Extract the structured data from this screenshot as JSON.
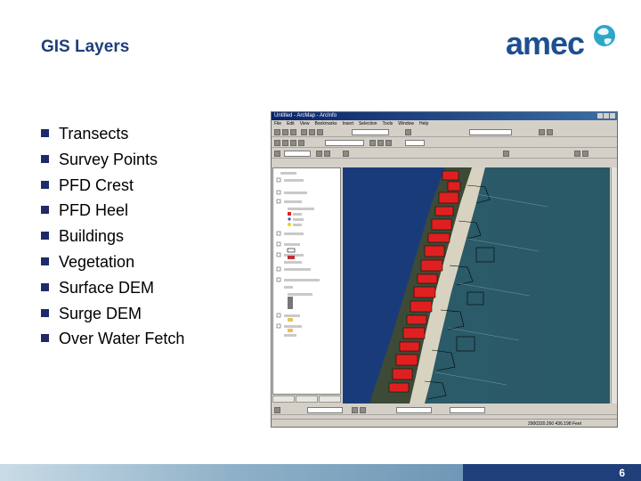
{
  "slide": {
    "title": "GIS Layers",
    "page_number": "6"
  },
  "logo": {
    "text": "amec"
  },
  "bullets": [
    "Transects",
    "Survey Points",
    "PFD Crest",
    "PFD Heel",
    "Buildings",
    "Vegetation",
    "Surface DEM",
    "Surge DEM",
    "Over Water Fetch"
  ],
  "gis_window": {
    "title": "Untitled - ArcMap - ArcInfo",
    "menu": [
      "File",
      "Edit",
      "View",
      "Bookmarks",
      "Insert",
      "Selection",
      "Tools",
      "Window",
      "Help"
    ],
    "status_coords": "2900320.260 436.198 Feet"
  },
  "colors": {
    "title": "#1f3f7a",
    "logo": "#1d4f91",
    "bullet_marker": "#1f2a6b",
    "footer_dark": "#1f3f7a",
    "building_fill": "#e02020",
    "ocean": "#1a3b7a",
    "beach": "#d8d3c0"
  }
}
